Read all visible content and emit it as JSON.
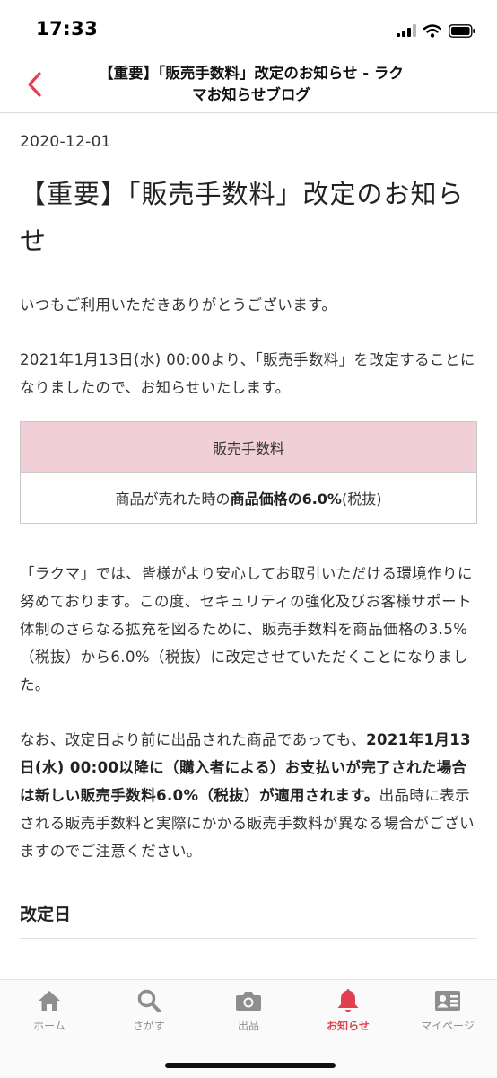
{
  "status": {
    "time": "17:33"
  },
  "nav": {
    "title": "【重要】「販売手数料」改定のお知らせ - ラクマお知らせブログ",
    "back_icon": "chevron-left-icon",
    "accent_color": "#e04050"
  },
  "post": {
    "date": "2020-12-01",
    "title": "【重要】「販売手数料」改定のお知らせ",
    "greeting": "いつもご利用いただきありがとうございます。",
    "intro": "2021年1月13日(水) 00:00より、「販売手数料」を改定することになりましたので、お知らせいたします。",
    "table": {
      "header": "販売手数料",
      "cell_prefix": "商品が売れた時の",
      "cell_bold": "商品価格の6.0%",
      "cell_suffix": " (税抜)",
      "header_color": "#f0cfd7"
    },
    "body": "「ラクマ」では、皆様がより安心してお取引いただける環境作りに努めております。この度、セキュリティの強化及びお客様サポート体制のさらなる拡充を図るために、販売手数料を商品価格の3.5%（税抜）から6.0%（税抜）に改定させていただくことになりました。",
    "note_prefix": "なお、改定日より前に出品された商品であっても、",
    "note_bold": "2021年1月13日(水) 00:00以降に（購入者による）お支払いが完了された場合は新しい販売手数料6.0%（税抜）が適用されます。",
    "note_suffix": "出品時に表示される販売手数料と実際にかかる販売手数料が異なる場合がございますのでご注意ください。",
    "section_heading": "改定日"
  },
  "tabs": [
    {
      "label": "ホーム",
      "icon": "home-icon",
      "active": false
    },
    {
      "label": "さがす",
      "icon": "search-icon",
      "active": false
    },
    {
      "label": "出品",
      "icon": "camera-icon",
      "active": false
    },
    {
      "label": "お知らせ",
      "icon": "bell-icon",
      "active": true
    },
    {
      "label": "マイページ",
      "icon": "profile-card-icon",
      "active": false
    }
  ]
}
